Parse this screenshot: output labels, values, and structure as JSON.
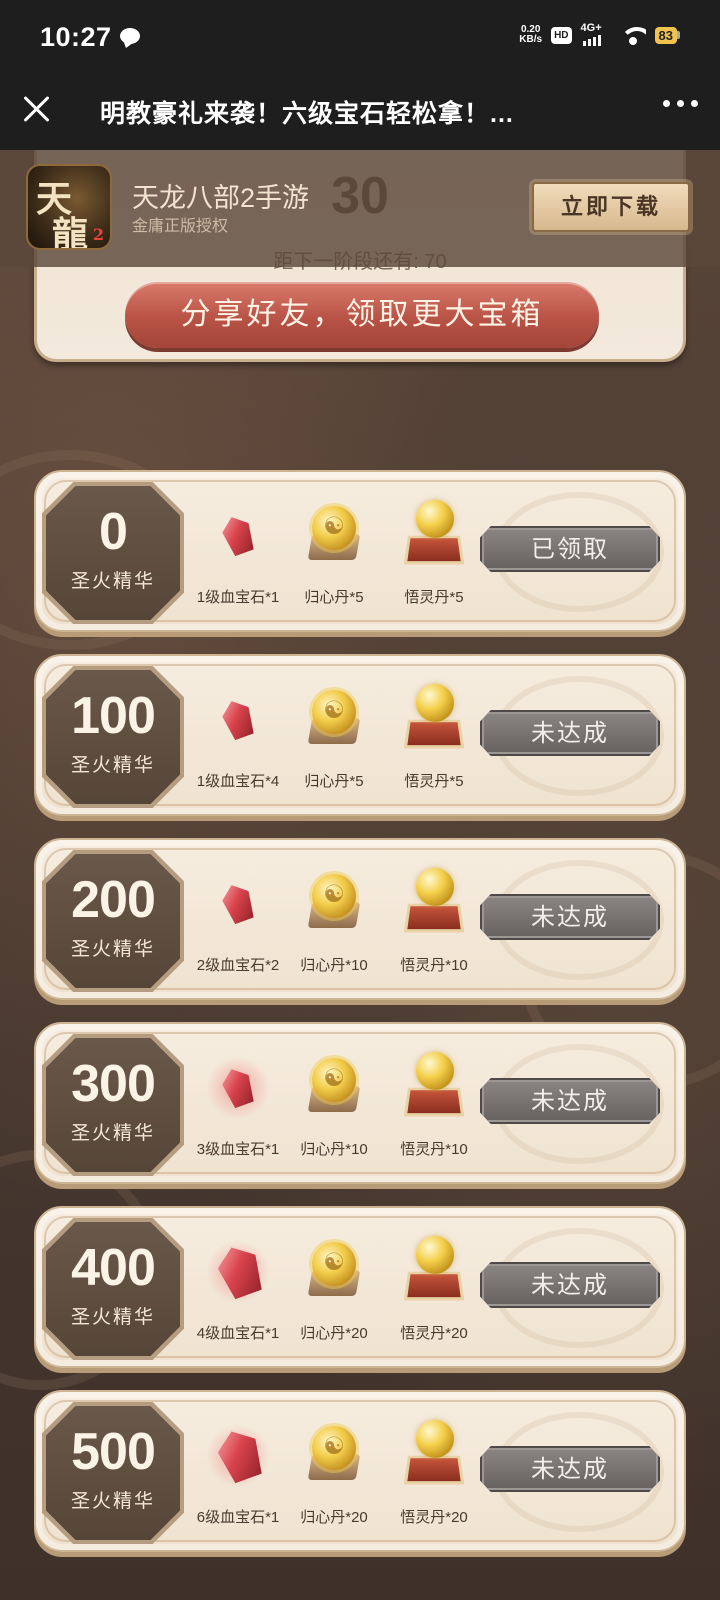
{
  "status_bar": {
    "time": "10:27",
    "net_speed_value": "0.20",
    "net_speed_unit": "KB/s",
    "hd": "HD",
    "network": "4G+",
    "battery": "83"
  },
  "title_bar": {
    "title": "明教豪礼来袭！六级宝石轻松拿！..."
  },
  "banner": {
    "app_name": "天龙八部2手游",
    "app_sub": "金庸正版授权",
    "download_label": "立即下载",
    "logo_text_1": "天",
    "logo_text_2": "龍",
    "logo_text_3": "2"
  },
  "share_panel": {
    "count": "30",
    "next_stage": "距下一阶段还有: 70",
    "share_label": "分享好友，领取更大宝箱"
  },
  "tiers": [
    {
      "value": "0",
      "unit": "圣火精华",
      "items": [
        "1级血宝石*1",
        "归心丹*5",
        "悟灵丹*5"
      ],
      "status": "已领取"
    },
    {
      "value": "100",
      "unit": "圣火精华",
      "items": [
        "1级血宝石*4",
        "归心丹*5",
        "悟灵丹*5"
      ],
      "status": "未达成"
    },
    {
      "value": "200",
      "unit": "圣火精华",
      "items": [
        "2级血宝石*2",
        "归心丹*10",
        "悟灵丹*10"
      ],
      "status": "未达成"
    },
    {
      "value": "300",
      "unit": "圣火精华",
      "items": [
        "3级血宝石*1",
        "归心丹*10",
        "悟灵丹*10"
      ],
      "status": "未达成"
    },
    {
      "value": "400",
      "unit": "圣火精华",
      "items": [
        "4级血宝石*1",
        "归心丹*20",
        "悟灵丹*20"
      ],
      "status": "未达成"
    },
    {
      "value": "500",
      "unit": "圣火精华",
      "items": [
        "6级血宝石*1",
        "归心丹*20",
        "悟灵丹*20"
      ],
      "status": "未达成"
    }
  ]
}
